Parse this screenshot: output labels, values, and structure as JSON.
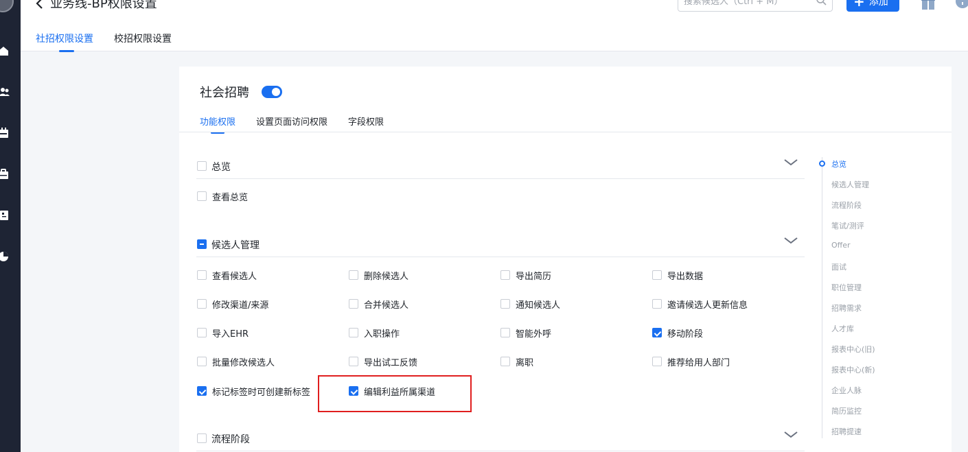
{
  "header": {
    "title": "业务线-BP权限设置",
    "search_placeholder": "搜索候选人（Ctrl + M）",
    "add_label": "添加",
    "add_icon": "plus-icon",
    "colors": {
      "primary": "#1a6ff0",
      "sidebar": "#1e2434",
      "highlight": "#e01e1e"
    }
  },
  "top_tabs": [
    {
      "label": "社招权限设置",
      "active": true
    },
    {
      "label": "校招权限设置",
      "active": false
    }
  ],
  "card": {
    "title": "社会招聘",
    "enabled": true,
    "subtabs": [
      {
        "label": "功能权限",
        "active": true
      },
      {
        "label": "设置页面访问权限",
        "active": false
      },
      {
        "label": "字段权限",
        "active": false
      }
    ]
  },
  "sections": {
    "overview": {
      "label": "总览",
      "state": "unchecked",
      "items": [
        {
          "label": "查看总览",
          "checked": false
        }
      ]
    },
    "candidate": {
      "label": "候选人管理",
      "state": "indeterminate",
      "items": [
        {
          "label": "查看候选人",
          "checked": false
        },
        {
          "label": "删除候选人",
          "checked": false
        },
        {
          "label": "导出简历",
          "checked": false
        },
        {
          "label": "导出数据",
          "checked": false
        },
        {
          "label": "修改渠道/来源",
          "checked": false
        },
        {
          "label": "合并候选人",
          "checked": false
        },
        {
          "label": "通知候选人",
          "checked": false
        },
        {
          "label": "邀请候选人更新信息",
          "checked": false
        },
        {
          "label": "导入EHR",
          "checked": false
        },
        {
          "label": "入职操作",
          "checked": false
        },
        {
          "label": "智能外呼",
          "checked": false
        },
        {
          "label": "移动阶段",
          "checked": true
        },
        {
          "label": "批量修改候选人",
          "checked": false
        },
        {
          "label": "导出试工反馈",
          "checked": false
        },
        {
          "label": "离职",
          "checked": false
        },
        {
          "label": "推荐给用人部门",
          "checked": false
        },
        {
          "label": "标记标签时可创建新标签",
          "checked": true
        },
        {
          "label": "编辑利益所属渠道",
          "checked": true
        }
      ]
    },
    "pipeline": {
      "label": "流程阶段",
      "state": "unchecked"
    }
  },
  "anchor_nav": [
    {
      "label": "总览",
      "active": true
    },
    {
      "label": "候选人管理",
      "active": false
    },
    {
      "label": "流程阶段",
      "active": false
    },
    {
      "label": "笔试/测评",
      "active": false
    },
    {
      "label": "Offer",
      "active": false
    },
    {
      "label": "面试",
      "active": false
    },
    {
      "label": "职位管理",
      "active": false
    },
    {
      "label": "招聘需求",
      "active": false
    },
    {
      "label": "人才库",
      "active": false
    },
    {
      "label": "报表中心(旧)",
      "active": false
    },
    {
      "label": "报表中心(新)",
      "active": false
    },
    {
      "label": "企业人脉",
      "active": false
    },
    {
      "label": "简历监控",
      "active": false
    },
    {
      "label": "招聘提速",
      "active": false
    }
  ]
}
